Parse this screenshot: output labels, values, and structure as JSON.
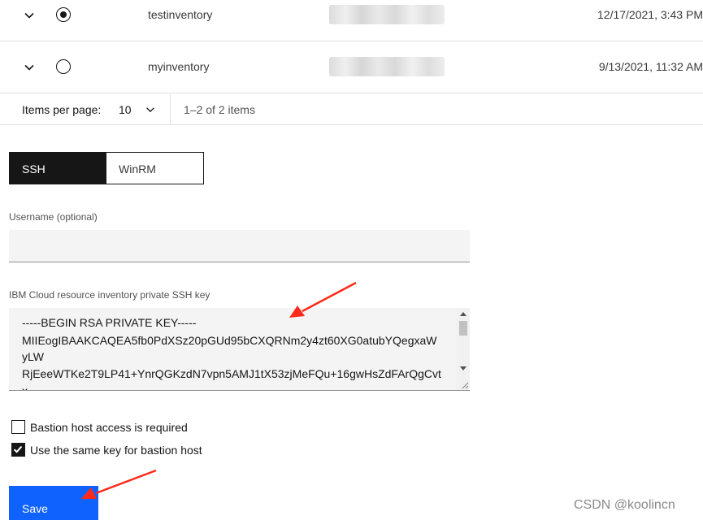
{
  "table": {
    "rows": [
      {
        "name": "testinventory",
        "date": "12/17/2021, 3:43 PM",
        "selected": true
      },
      {
        "name": "myinventory",
        "date": "9/13/2021, 11:32 AM",
        "selected": false
      }
    ]
  },
  "pagination": {
    "items_per_page_label": "Items per page:",
    "items_per_page_value": "10",
    "range_text": "1–2 of 2 items"
  },
  "protocol_switcher": {
    "options": [
      "SSH",
      "WinRM"
    ],
    "selected": "SSH"
  },
  "username": {
    "label": "Username (optional)",
    "value": ""
  },
  "ssh_key": {
    "label": "IBM Cloud resource inventory private SSH key",
    "lines": [
      "-----BEGIN RSA PRIVATE KEY-----",
      "MIIEogIBAAKCAQEA5fb0PdXSz20pGUd95bCXQRNm2y4zt60XG0atubYQegxaW",
      "yLW",
      "RjEeeWTKe2T9LP41+YnrQGKzdN7vpn5AMJ1tX53zjMeFQu+16gwHsZdFArQgCvt",
      "x"
    ]
  },
  "checkboxes": {
    "bastion_required": {
      "label": "Bastion host access is required",
      "checked": false
    },
    "same_key": {
      "label": "Use the same key for bastion host",
      "checked": true
    }
  },
  "save_button": {
    "label": "Save"
  },
  "colors": {
    "primary": "#0f62fe",
    "annotation_arrow": "#ff2a1a",
    "dark": "#161616"
  },
  "watermark": "CSDN @koolincn"
}
